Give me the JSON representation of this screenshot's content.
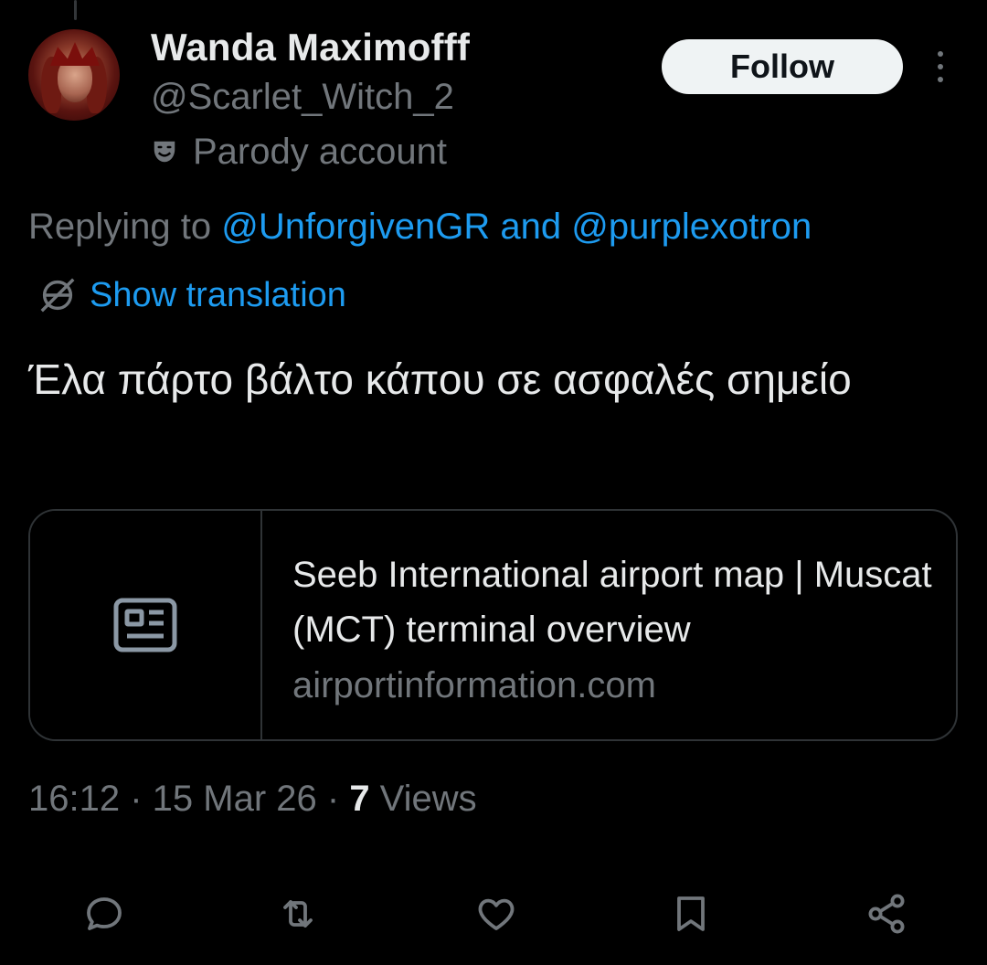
{
  "author": {
    "display_name": "Wanda Maximofff",
    "handle": "@Scarlet_Witch_2",
    "parody_label": "Parody account",
    "avatar_icon": "profile-photo",
    "parody_icon": "theater-masks-icon"
  },
  "follow_button": {
    "label": "Follow"
  },
  "more_icon": "more-dots-icon",
  "reply_context": {
    "prefix": "Replying to ",
    "mention_1": "@UnforgivenGR",
    "joiner": " and ",
    "mention_2": "@purplexotron"
  },
  "translation": {
    "label": "Show translation",
    "icon": "globe-icon"
  },
  "tweet": {
    "text": "Έλα πάρτο βάλτο κάπου σε ασφαλές σημείο"
  },
  "link_card": {
    "title": "Seeb International airport map | Muscat (MCT) terminal overview",
    "domain": "airportinformation.com",
    "thumbnail_icon": "news-article-icon"
  },
  "meta": {
    "time": "16:12",
    "separator": " · ",
    "date": "15 Mar 26",
    "views_count": "7",
    "views_label": " Views"
  },
  "actions": [
    {
      "icon": "reply-icon"
    },
    {
      "icon": "retweet-icon"
    },
    {
      "icon": "like-icon"
    },
    {
      "icon": "bookmark-icon"
    },
    {
      "icon": "share-icon"
    }
  ],
  "colors": {
    "background": "#000000",
    "primary_text": "#e7e9ea",
    "secondary_text": "#71767b",
    "accent": "#1d9bf0",
    "border": "#2f3336",
    "follow_bg": "#eff3f4"
  }
}
